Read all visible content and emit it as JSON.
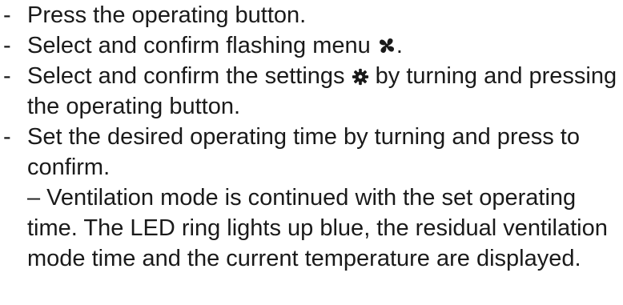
{
  "instructions": {
    "bullet": "-",
    "steps": [
      {
        "text": "Press the operating button."
      },
      {
        "text_before": "Select and confirm flashing menu ",
        "icon": "fan-icon",
        "text_after": "."
      },
      {
        "text_before": "Select and confirm the settings ",
        "icon": "gear-icon",
        "text_after": " by turning and pressing the operating button."
      },
      {
        "text": "Set the desired operating time by turning and press to confirm.",
        "note": "– Ventilation mode is continued with the set operating time. The LED ring lights up blue, the residual ventilation mode time and the current temperature are displayed."
      }
    ]
  }
}
